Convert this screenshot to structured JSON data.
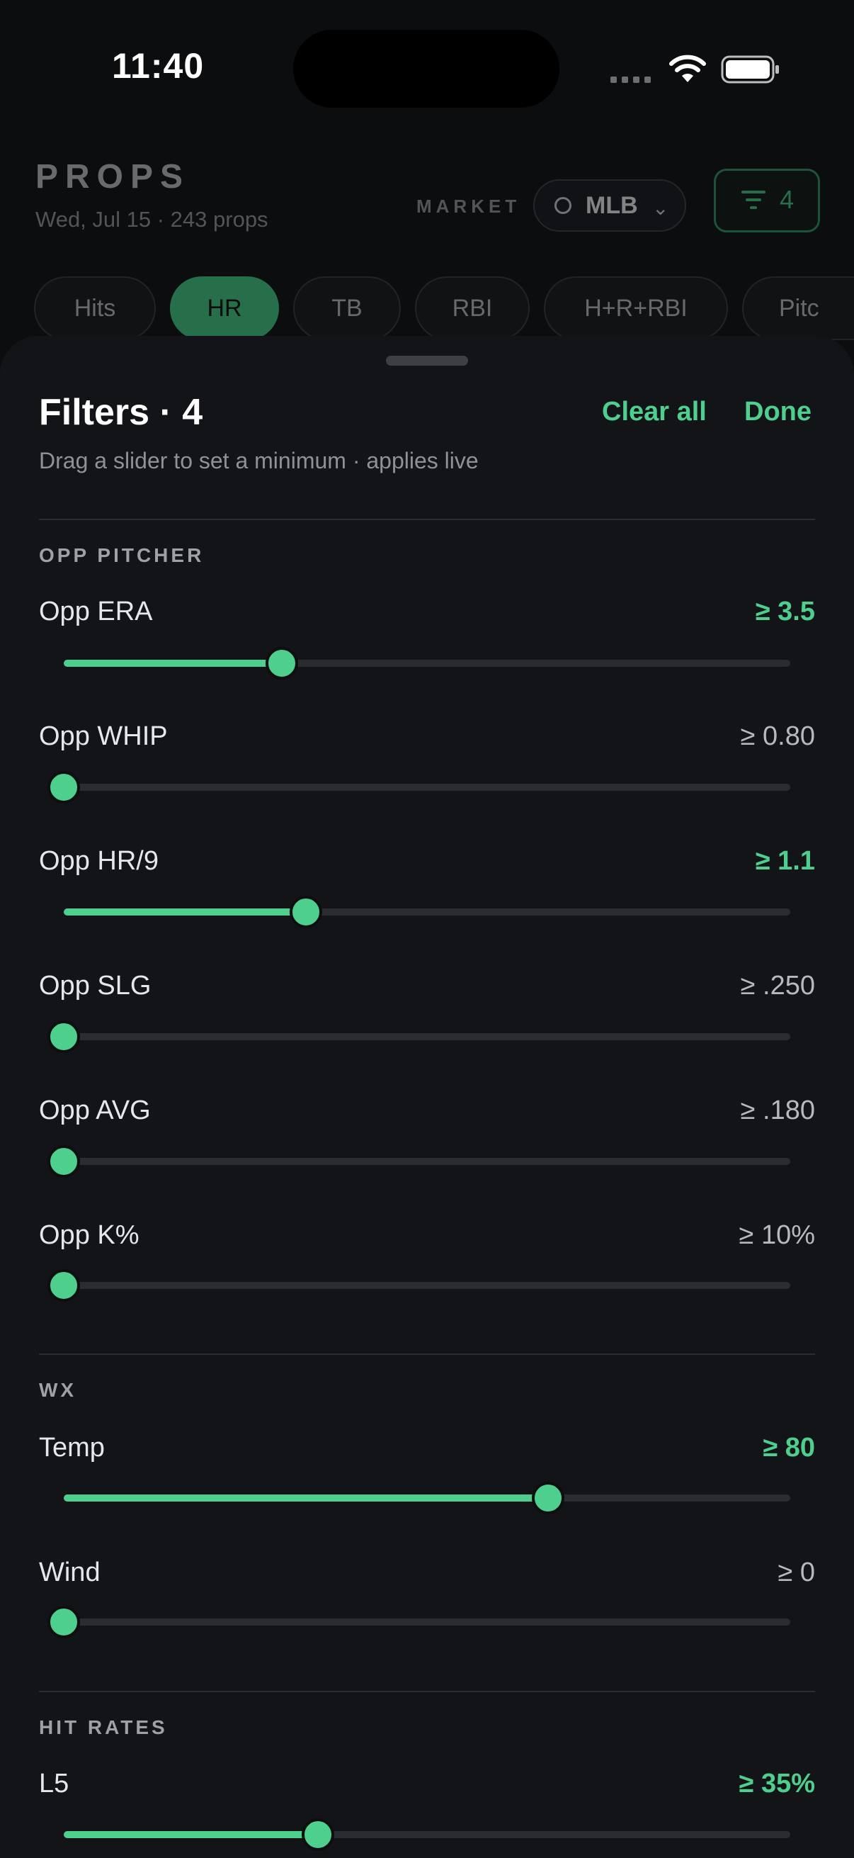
{
  "status_bar": {
    "time": "11:40"
  },
  "header": {
    "title": "PROPS",
    "subtitle": "Wed, Jul 15 · 243 props",
    "market_label": "MARKET",
    "market_value": "MLB",
    "filter_count": "4"
  },
  "tabs": [
    {
      "label": "Hits",
      "active": false
    },
    {
      "label": "HR",
      "active": true
    },
    {
      "label": "TB",
      "active": false
    },
    {
      "label": "RBI",
      "active": false
    },
    {
      "label": "H+R+RBI",
      "active": false
    },
    {
      "label": "Pitc",
      "active": false
    }
  ],
  "sheet": {
    "title": "Filters · 4",
    "clear_label": "Clear all",
    "done_label": "Done",
    "subtitle": "Drag a slider to set a minimum · applies live"
  },
  "sections": [
    {
      "title": "OPP PITCHER",
      "filters": [
        {
          "label": "Opp ERA",
          "value": "≥ 3.5",
          "active": true,
          "level": 0.3
        },
        {
          "label": "Opp WHIP",
          "value": "≥ 0.80",
          "active": false,
          "level": 0.0
        },
        {
          "label": "Opp HR/9",
          "value": "≥ 1.1",
          "active": true,
          "level": 0.333
        },
        {
          "label": "Opp SLG",
          "value": "≥ .250",
          "active": false,
          "level": 0.0
        },
        {
          "label": "Opp AVG",
          "value": "≥ .180",
          "active": false,
          "level": 0.0
        },
        {
          "label": "Opp K%",
          "value": "≥ 10%",
          "active": false,
          "level": 0.0
        }
      ]
    },
    {
      "title": "WX",
      "filters": [
        {
          "label": "Temp",
          "value": "≥ 80",
          "active": true,
          "level": 0.667
        },
        {
          "label": "Wind",
          "value": "≥ 0",
          "active": false,
          "level": 0.0
        }
      ]
    },
    {
      "title": "HIT RATES",
      "filters": [
        {
          "label": "L5",
          "value": "≥ 35%",
          "active": true,
          "level": 0.35
        }
      ]
    }
  ],
  "colors": {
    "accent": "#4ecf8e",
    "sheet_bg": "#131418",
    "track": "#2a2c31"
  }
}
